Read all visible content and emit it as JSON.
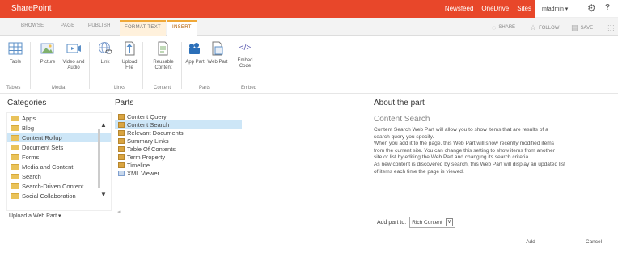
{
  "suitebar": {
    "brand": "SharePoint",
    "links": [
      "Newsfeed",
      "OneDrive",
      "Sites"
    ],
    "user": "mtadmin ▾"
  },
  "tabs": [
    "BROWSE",
    "PAGE",
    "PUBLISH",
    "FORMAT TEXT",
    "INSERT"
  ],
  "ribbon_tools": [
    "SHARE",
    "FOLLOW",
    "SAVE"
  ],
  "ribbon": {
    "buttons": [
      {
        "label": "Table",
        "icon": "table-icon"
      },
      {
        "label": "Picture",
        "icon": "picture-icon"
      },
      {
        "label": "Video and Audio",
        "icon": "video-icon"
      },
      {
        "label": "Link",
        "icon": "link-icon"
      },
      {
        "label": "Upload File",
        "icon": "upload-icon"
      },
      {
        "label": "Reusable Content",
        "icon": "reusable-content-icon"
      },
      {
        "label": "App Part",
        "icon": "app-part-icon"
      },
      {
        "label": "Web Part",
        "icon": "web-part-icon"
      },
      {
        "label": "Embed Code",
        "icon": "embed-code-icon"
      }
    ],
    "groups": [
      "Tables",
      "Media",
      "Links",
      "Content",
      "Parts",
      "Embed"
    ]
  },
  "categories": {
    "heading": "Categories",
    "items": [
      "Apps",
      "Blog",
      "Content Rollup",
      "Document Sets",
      "Forms",
      "Media and Content",
      "Search",
      "Search-Driven Content",
      "Social Collaboration"
    ],
    "selected_index": 2,
    "upload": "Upload a Web Part ▾"
  },
  "parts": {
    "heading": "Parts",
    "items": [
      "Content Query",
      "Content Search",
      "Relevant Documents",
      "Summary Links",
      "Table Of Contents",
      "Term Property",
      "Timeline",
      "XML Viewer"
    ],
    "selected_index": 1
  },
  "about": {
    "heading": "About the part",
    "title": "Content Search",
    "description": [
      "Content Search Web Part will allow you to show items that are results of a",
      "search query you specify.",
      "When you add it to the page, this Web Part will show recently modified items",
      "from the current site. You can change this setting to show items from another",
      "site or list by editing the Web Part and changing its search criteria.",
      "As new content is discovered by search, this Web Part will display an updated list",
      "of items each time the page is viewed."
    ]
  },
  "addpart": {
    "label": "Add part to:",
    "value": "Rich Content"
  },
  "buttons": {
    "add": "Add",
    "cancel": "Cancel"
  }
}
